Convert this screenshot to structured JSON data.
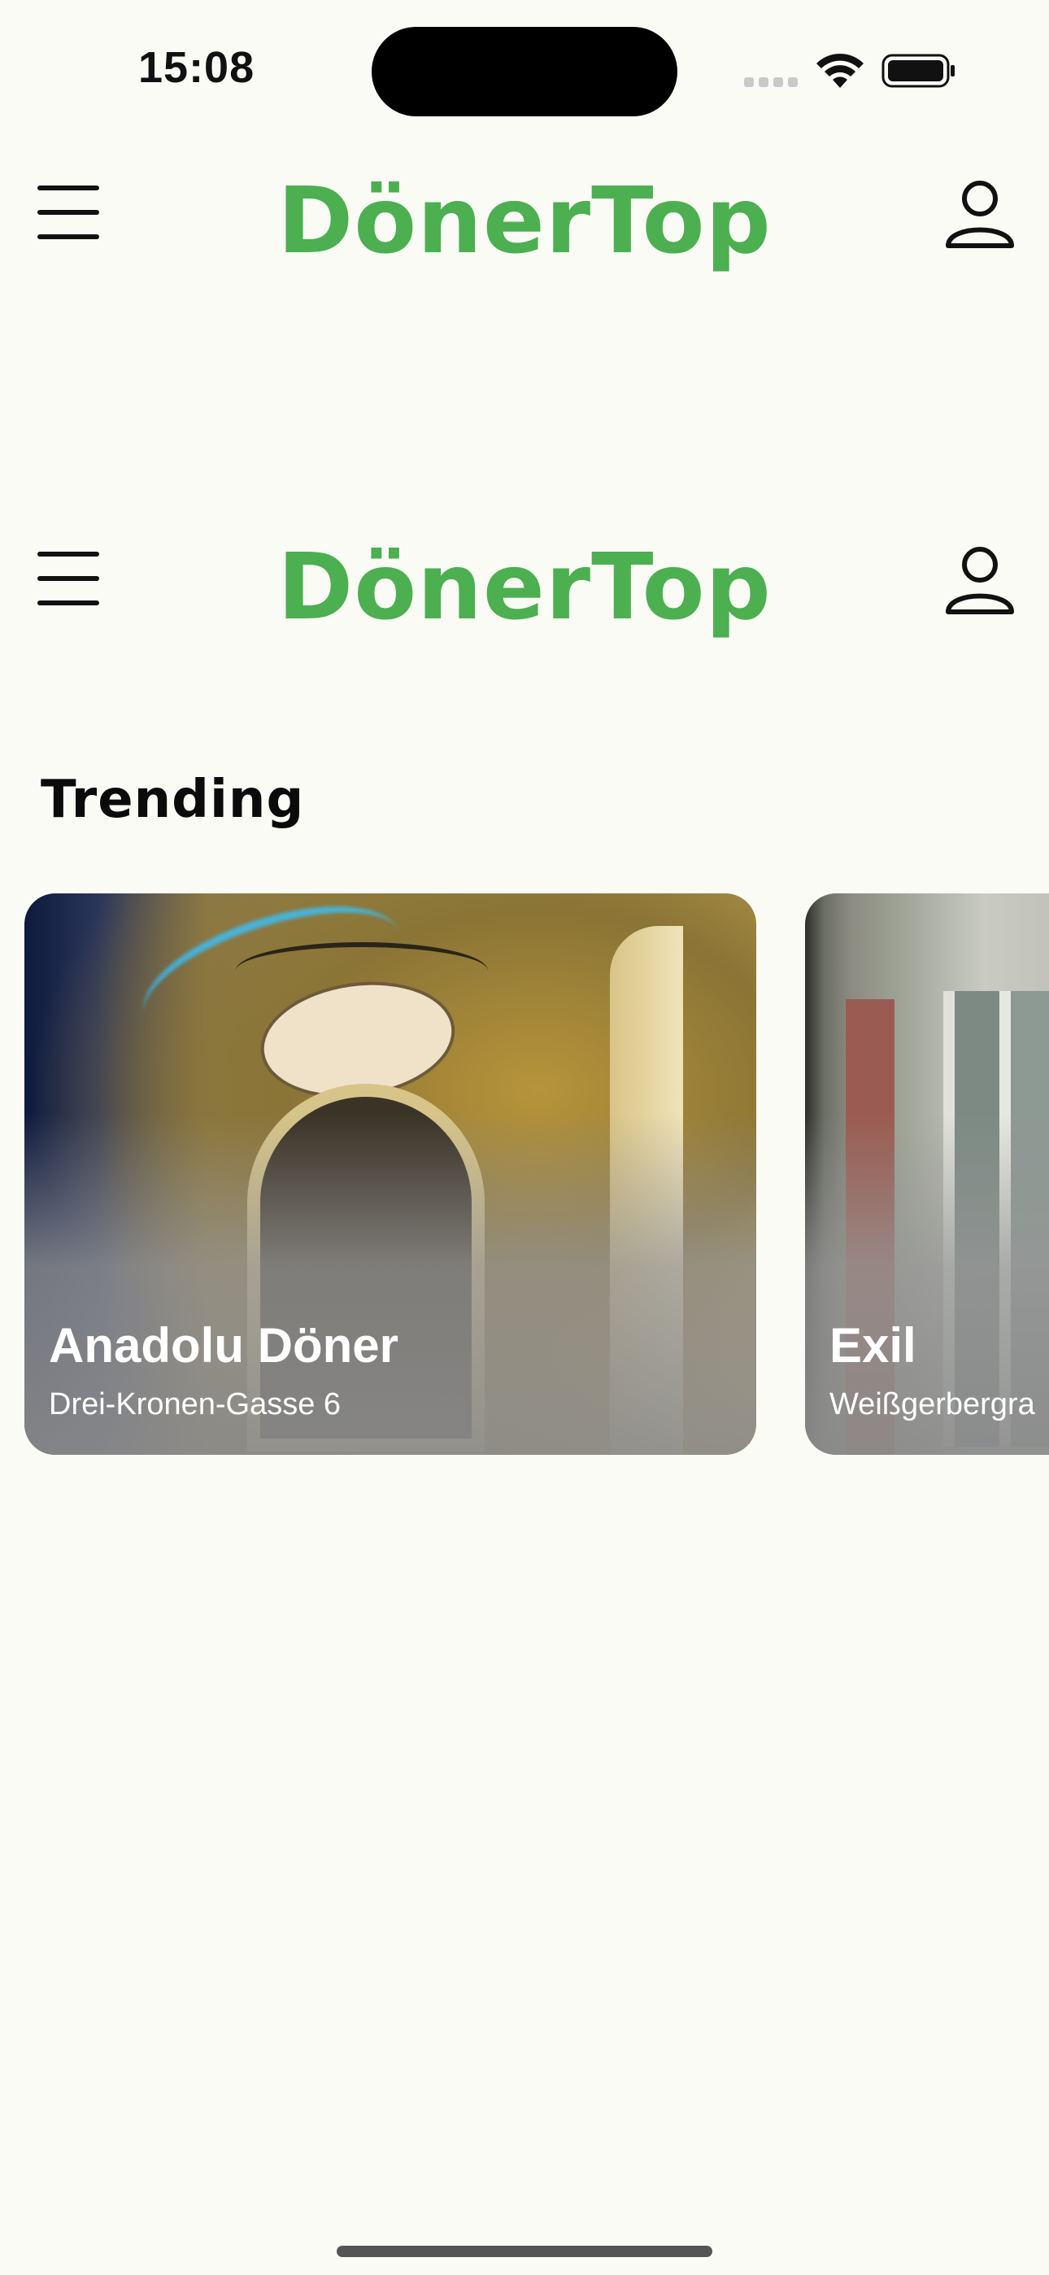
{
  "status_bar": {
    "time": "15:08",
    "icons": [
      "cellular-signal-icon",
      "wifi-icon",
      "battery-icon"
    ]
  },
  "header": {
    "logo": "DönerTop",
    "menu_icon": "hamburger-menu-icon",
    "profile_icon": "person-icon",
    "brand_color": "#4caf50"
  },
  "trending": {
    "title": "Trending",
    "items": [
      {
        "name": "Anadolu Döner",
        "address": "Drei-Kronen-Gasse 6"
      },
      {
        "name": "Exil",
        "address": "Weißgerbergra"
      }
    ]
  }
}
